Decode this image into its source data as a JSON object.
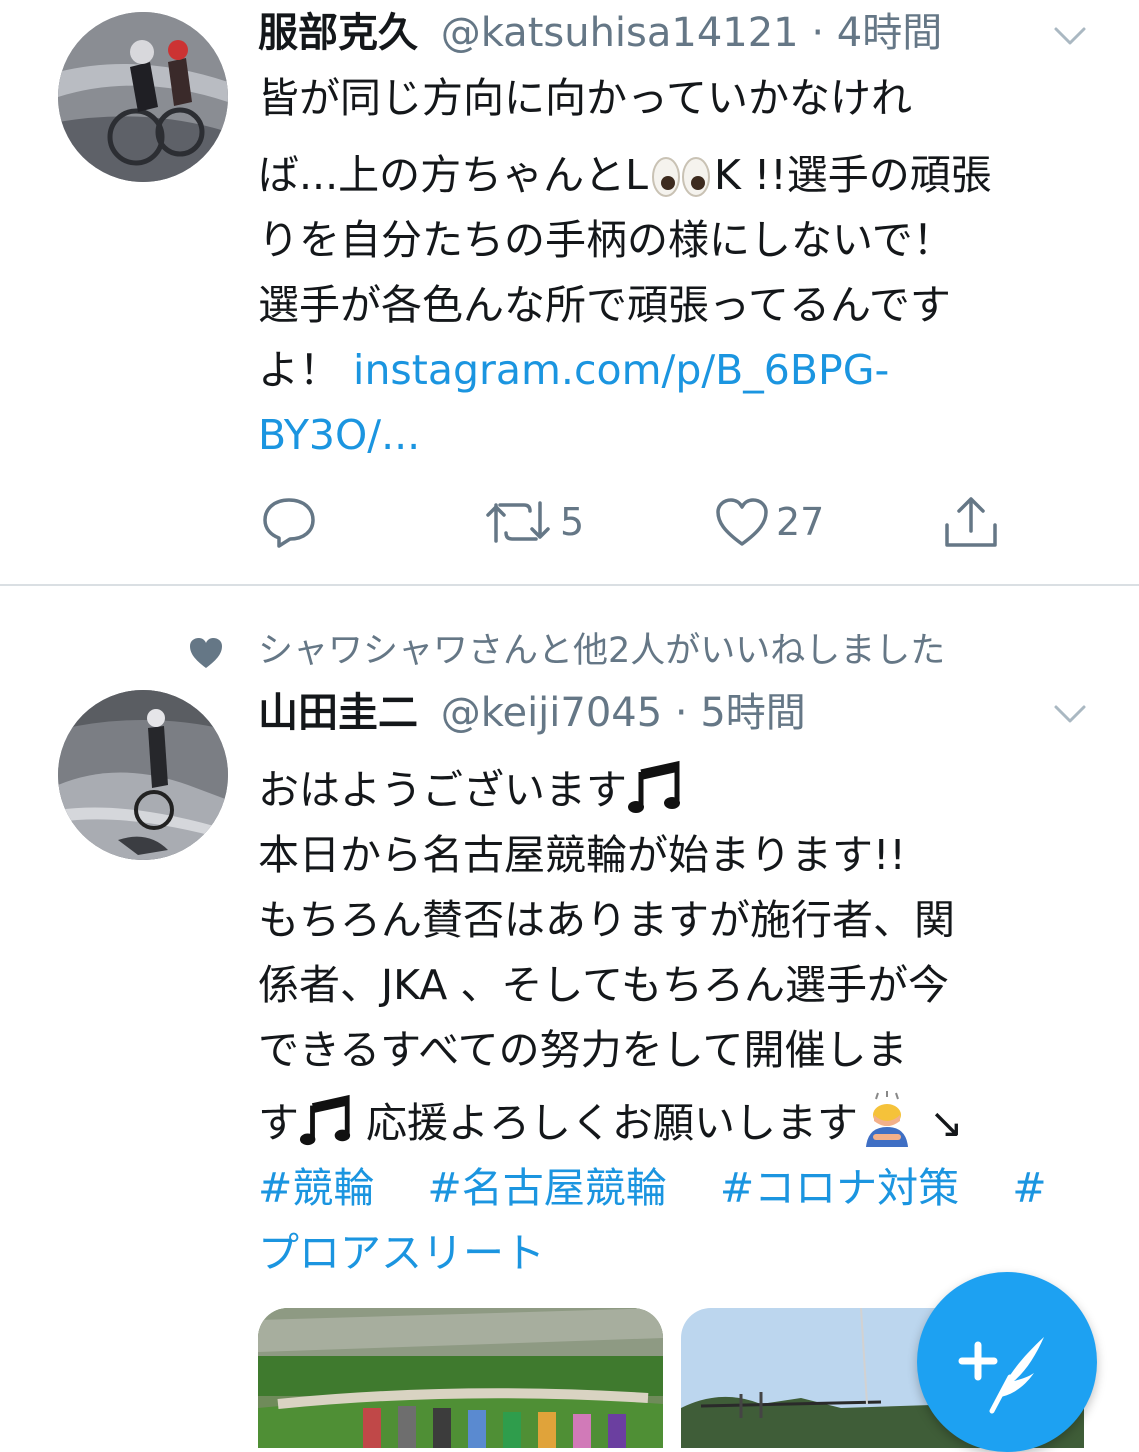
{
  "tweets": [
    {
      "display_name": "服部克久",
      "handle": "@katsuhisa14121",
      "separator": "·",
      "time": "4時間",
      "lines": {
        "l1": "皆が同じ方向に向かっていかなけれ",
        "l2a": "ば...上の方ちゃんとL",
        "l2b": "K !!選手の頑張",
        "l3": "りを自分たちの手柄の様にしないで！",
        "l4": "選手が各色んな所で頑張ってるんです",
        "l5a": "よ！ ",
        "l5_link": "instagram.com/p/B_6BPG-",
        "l6_link": "BY3O/..."
      },
      "actions": {
        "retweets": "5",
        "likes": "27"
      }
    },
    {
      "social_context": "シャワシャワさんと他2人がいいねしました",
      "display_name": "山田圭二",
      "handle": "@keiji7045",
      "separator": "·",
      "time": "5時間",
      "lines": {
        "l1": "おはようございます",
        "l2": "本日から名古屋競輪が始まります!!",
        "l3": "もちろん賛否はありますが施行者、関",
        "l4": "係者、JKA 、そしてもちろん選手が今",
        "l5": "できるすべての努力をして開催しま",
        "l6a": "す",
        "l6b": " 応援よろしくお願いします",
        "l6c": " ↘"
      },
      "hashtags": [
        "#競輪",
        "#名古屋競輪",
        "#コロナ対策",
        "#",
        "プロアスリート"
      ]
    }
  ],
  "icons": {
    "reply": "reply-icon",
    "retweet": "retweet-icon",
    "like": "heart-icon",
    "share": "share-icon",
    "more": "chevron-down-icon",
    "compose": "compose-tweet-icon"
  },
  "colors": {
    "link": "#1b95e0",
    "secondary_text": "#657786",
    "fab": "#1da1f2"
  }
}
